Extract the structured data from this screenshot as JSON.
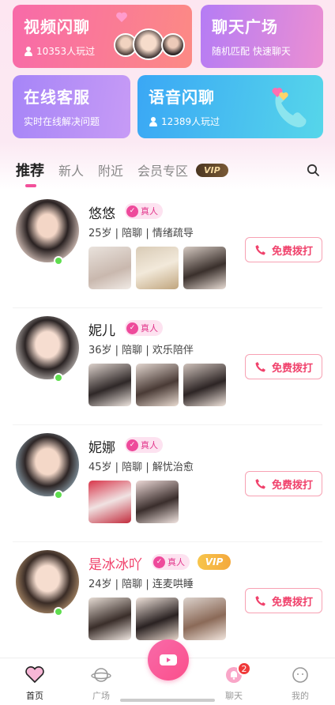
{
  "banners": {
    "video": {
      "title": "视频闪聊",
      "players": "10353人玩过"
    },
    "square": {
      "title": "聊天广场",
      "sub": "随机匹配 快速聊天"
    },
    "service": {
      "title": "在线客服",
      "sub": "实时在线解决问题"
    },
    "voice": {
      "title": "语音闪聊",
      "players": "12389人玩过"
    }
  },
  "tabs": [
    {
      "label": "推荐",
      "active": true
    },
    {
      "label": "新人",
      "active": false
    },
    {
      "label": "附近",
      "active": false
    },
    {
      "label": "会员专区",
      "active": false
    }
  ],
  "vip_tab_badge": "VIP",
  "users": [
    {
      "name": "悠悠",
      "real_label": "真人",
      "info": "25岁 | 陪聊 | 情绪疏导",
      "vip": false,
      "call_label": "免费拨打"
    },
    {
      "name": "妮儿",
      "real_label": "真人",
      "info": "36岁 | 陪聊 | 欢乐陪伴",
      "vip": false,
      "call_label": "免费拨打"
    },
    {
      "name": "妮娜",
      "real_label": "真人",
      "info": "45岁 | 陪聊 | 解忧治愈",
      "vip": false,
      "call_label": "免费拨打"
    },
    {
      "name": "是冰冰吖",
      "real_label": "真人",
      "vip_label": "VIP",
      "info": "24岁 | 陪聊 | 连麦哄睡",
      "vip": true,
      "call_label": "免费拨打"
    }
  ],
  "nav": {
    "home": "首页",
    "square": "广场",
    "chat": "聊天",
    "chat_badge": "2",
    "mine": "我的"
  },
  "colors": {
    "accent": "#f24f9a",
    "call": "#f0416b",
    "online": "#5fdd4f"
  }
}
